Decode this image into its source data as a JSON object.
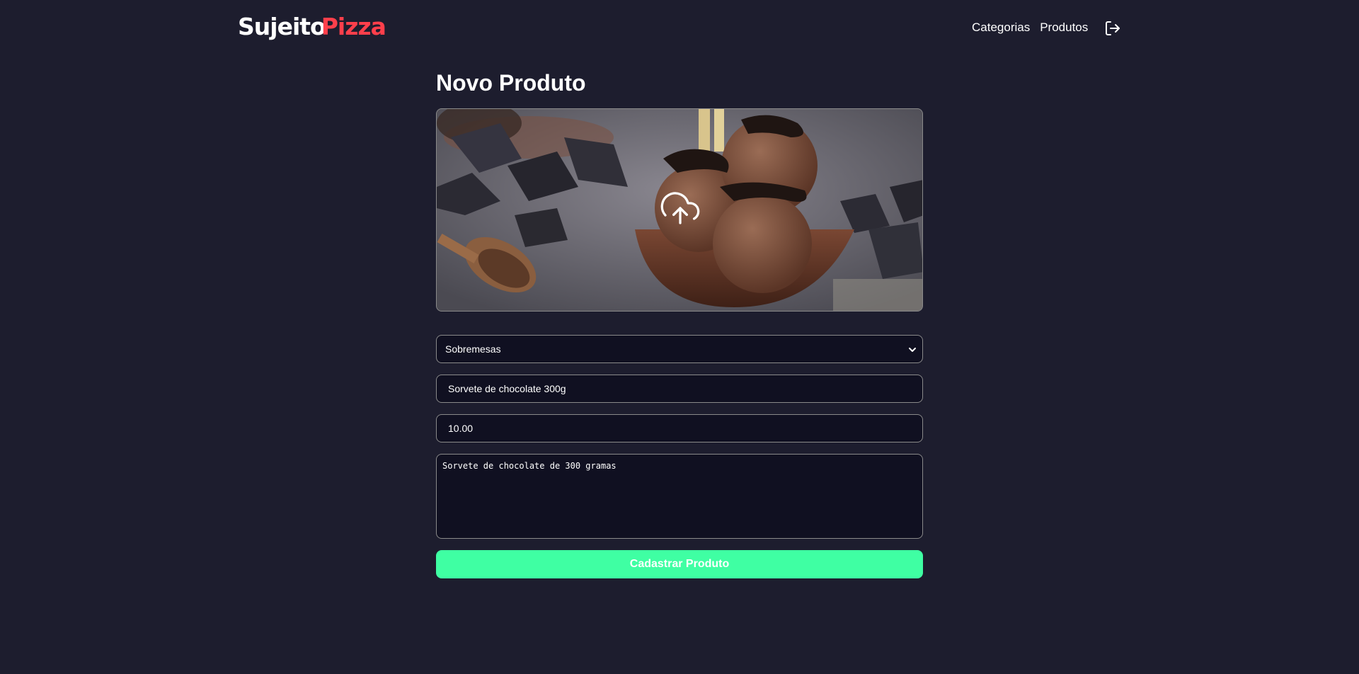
{
  "header": {
    "logo_part1": "Sujeito",
    "logo_part2": "Pizza",
    "nav": [
      {
        "label": "Categorias"
      },
      {
        "label": "Produtos"
      }
    ],
    "logout_icon": "logout-icon"
  },
  "main": {
    "title": "Novo Produto",
    "upload_icon": "upload-cloud-icon",
    "category": {
      "selected": "Sobremesas"
    },
    "name": {
      "value": "Sorvete de chocolate 300g"
    },
    "price": {
      "value": "10.00"
    },
    "description": {
      "value": "Sorvete de chocolate de 300 gramas"
    },
    "submit_label": "Cadastrar Produto"
  },
  "colors": {
    "background": "#1d1d2e",
    "input_background": "#101021",
    "accent_red": "#ff3f4b",
    "accent_green": "#3fffa3"
  }
}
